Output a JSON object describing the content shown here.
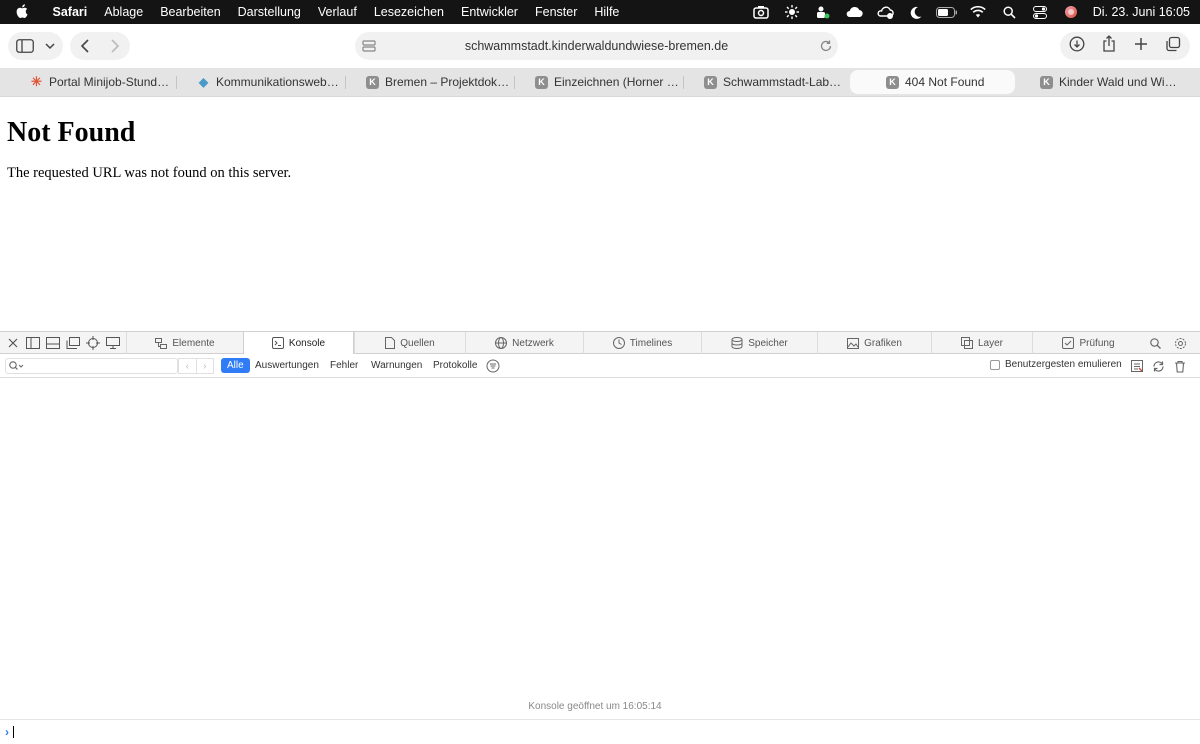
{
  "menubar": {
    "app_name": "Safari",
    "items": [
      "Ablage",
      "Bearbeiten",
      "Darstellung",
      "Verlauf",
      "Lesezeichen",
      "Entwickler",
      "Fenster",
      "Hilfe"
    ],
    "clock": "Di. 23. Juni  16:05",
    "status_icons": [
      "screenshot-icon",
      "brightness-icon",
      "app-icon",
      "cloud-icon",
      "vpn-icon",
      "moon-icon",
      "battery-icon",
      "wifi-icon",
      "spotlight-icon",
      "control-center-icon",
      "siri-icon"
    ]
  },
  "toolbar": {
    "address": "schwammstadt.kinderwaldundwiese-bremen.de"
  },
  "tabs": [
    {
      "label": "Portal Minijob-Stunde...",
      "favicon": "✳",
      "active": false
    },
    {
      "label": "Kommunikationswebsi...",
      "favicon": "◆",
      "active": false
    },
    {
      "label": "Bremen – Projektdoku...",
      "favicon": "K",
      "active": false
    },
    {
      "label": "Einzeichnen (Horner S...",
      "favicon": "K",
      "active": false
    },
    {
      "label": "Schwammstadt-Labor...",
      "favicon": "K",
      "active": false
    },
    {
      "label": "404 Not Found",
      "favicon": "K",
      "active": true
    },
    {
      "label": "Kinder Wald und Wies...",
      "favicon": "K",
      "active": false
    }
  ],
  "page": {
    "heading": "Not Found",
    "message": "The requested URL was not found on this server."
  },
  "inspector": {
    "tabs": [
      "Elemente",
      "Konsole",
      "Quellen",
      "Netzwerk",
      "Timelines",
      "Speicher",
      "Grafiken",
      "Layer",
      "Prüfung"
    ],
    "active_tab": "Konsole",
    "filters": [
      "Alle",
      "Auswertungen",
      "Fehler",
      "Warnungen",
      "Protokolle"
    ],
    "active_filter": "Alle",
    "emulate_label": "Benutzergesten emulieren",
    "console_opened": "Konsole geöffnet um 16:05:14",
    "accent_color": "#2f7cf6"
  }
}
